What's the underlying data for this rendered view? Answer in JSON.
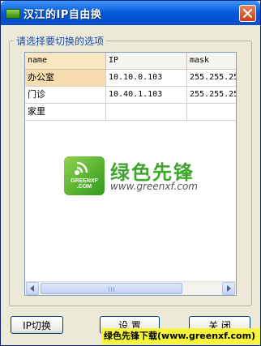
{
  "window": {
    "title": "汉江的IP自由换",
    "close_label": "×"
  },
  "group": {
    "label": "请选择要切换的选项"
  },
  "grid": {
    "columns": [
      "name",
      "IP",
      "mask"
    ],
    "rows": [
      {
        "name": "办公室",
        "ip": "10.10.0.103",
        "mask": "255.255.25"
      },
      {
        "name": "门诊",
        "ip": "10.40.1.103",
        "mask": "255.255.25"
      },
      {
        "name": "家里",
        "ip": "",
        "mask": ""
      }
    ]
  },
  "watermark": {
    "logo_text": "GREENXF .COM",
    "brand": "绿色先锋",
    "url": "www.greenxf.com"
  },
  "buttons": {
    "switch_ip": "IP切换",
    "settings": "设 置",
    "close": "关 闭"
  },
  "banner": {
    "text": "绿色先锋下载(www.greenxf.com)"
  },
  "colors": {
    "title_bar": "#0a5fd8",
    "selection": "#f6dcae",
    "brand_green": "#3da62b"
  }
}
